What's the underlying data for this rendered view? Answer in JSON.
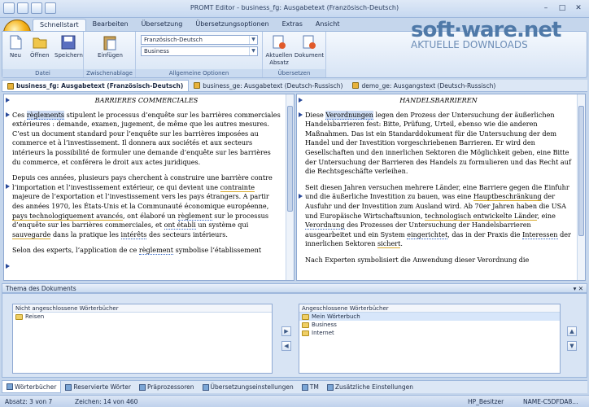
{
  "window": {
    "title": "PROMT Editor - business_fg: Ausgabetext (Französisch-Deutsch)"
  },
  "ribbon": {
    "tabs": [
      "Schnellstart",
      "Bearbeiten",
      "Übersetzung",
      "Übersetzungsoptionen",
      "Extras",
      "Ansicht"
    ],
    "active_tab": "Schnellstart",
    "groups": {
      "datei": {
        "label": "Datei",
        "buttons": [
          "Neu",
          "Öffnen",
          "Speichern"
        ]
      },
      "zwischenablage": {
        "label": "Zwischenablage",
        "buttons": [
          "Einfügen"
        ]
      },
      "optionen": {
        "label": "Allgemeine Optionen",
        "direction": "Französisch-Deutsch",
        "profile": "Business"
      },
      "uebersetzen": {
        "label": "Übersetzen",
        "buttons": [
          "Aktuellen Absatz",
          "Dokument"
        ]
      }
    }
  },
  "watermark": {
    "line1": "soft·ware.net",
    "line2": "AKTUELLE DOWNLOADS"
  },
  "document_tabs": [
    {
      "label": "business_fg: Ausgabetext (Französisch-Deutsch)",
      "active": true
    },
    {
      "label": "business_ge: Ausgabetext (Deutsch-Russisch)",
      "active": false
    },
    {
      "label": "demo_ge: Ausgangstext (Deutsch-Russisch)",
      "active": false
    }
  ],
  "source_pane": {
    "heading": "BARRIERES COMMERCIALES",
    "p1": [
      "Ces ",
      "règlements",
      " stipulent le processus d’enquête sur les barrières commerciales extérieures : demande, examen, jugement, de même que les autres mesures. C’est un document standard pour l’enquête sur les barrières imposées au commerce et à l’investissement. Il donnera aux sociétés et aux secteurs intérieurs la possibilité de formuler une demande d’enquête sur les barrières du commerce, et conférera le droit aux actes juridiques."
    ],
    "p2": [
      "Depuis ces années, plusieurs pays cherchent à construire une barrière contre l’importation et l’investissement extérieur, ce qui devient une ",
      "contrainte",
      " majeure de l’exportation et l’investissement vers les pays étrangers. A partir des années 1970, les États-Unis et la Communauté économique européenne, ",
      "pays technologiquement avancés",
      ", ont élaboré un ",
      "règlement",
      " sur le processus d’enquête sur les barrières commerciales, et ",
      "ont établi",
      " un système qui ",
      "sauvegarde",
      " dans la pratique les ",
      "intérêts",
      " des secteurs intérieurs."
    ],
    "p3": [
      "Selon des experts, l’application de ce ",
      "règlement",
      " symbolise l’établissement"
    ]
  },
  "target_pane": {
    "heading": "HANDELSBARRIEREN",
    "p1": [
      "Diese ",
      "Verordnungen",
      " legen den Prozess der Untersuchung der äußerlichen Handelsbarrieren fest: Bitte, Prüfung, Urteil, ebenso wie die anderen Maßnahmen. Das ist ein Standarddokument für die Untersuchung der dem Handel und der Investition vorgeschriebenen Barrieren. Er wird den Gesellschaften und den innerlichen Sektoren die Möglichkeit geben, eine Bitte der Untersuchung der Barrieren des Handels zu formulieren und das Recht auf die Rechtsgeschäfte verleihen."
    ],
    "p2": [
      "Seit diesen Jahren versuchen mehrere Länder, eine Barriere gegen die Einfuhr und die äußerliche Investition zu bauen, was eine ",
      "Hauptbeschränkung",
      " der Ausfuhr und der Investition zum Ausland wird. Ab 70er Jahren haben die USA und Europäische Wirtschaftsunion, ",
      "technologisch entwickelte Länder",
      ", eine ",
      "Verordnung",
      " des Prozesses der Untersuchung der Handelsbarrieren ausgearbeitet und ein System ",
      "eingerichtet",
      ", das in der Praxis die ",
      "Interessen",
      " der innerlichen Sektoren ",
      "sichert",
      "."
    ],
    "p3": [
      "Nach Experten symbolisiert die Anwendung dieser Verordnung die"
    ]
  },
  "theme_panel": {
    "title": "Thema des Dokuments",
    "left_header": "Nicht angeschlossene Wörterbücher",
    "left_items": [
      "Reisen"
    ],
    "right_header": "Angeschlossene Wörterbücher",
    "right_items": [
      "Mein Wörterbuch",
      "Business",
      "Internet"
    ]
  },
  "bottom_tabs": [
    "Wörterbücher",
    "Reservierte Wörter",
    "Präprozessoren",
    "Übersetzungseinstellungen",
    "TM",
    "Zusätzliche Einstellungen"
  ],
  "status": {
    "paragraph": "Absatz: 3 von 7",
    "chars": "Zeichen: 14 von 460",
    "user": "HP_Besitzer",
    "machine": "NAME-C5DFDA8..."
  },
  "colors": {
    "accent": "#4f79a8",
    "ribbon_bg": "#d7e4f5",
    "highlight": "#cddcf3"
  }
}
